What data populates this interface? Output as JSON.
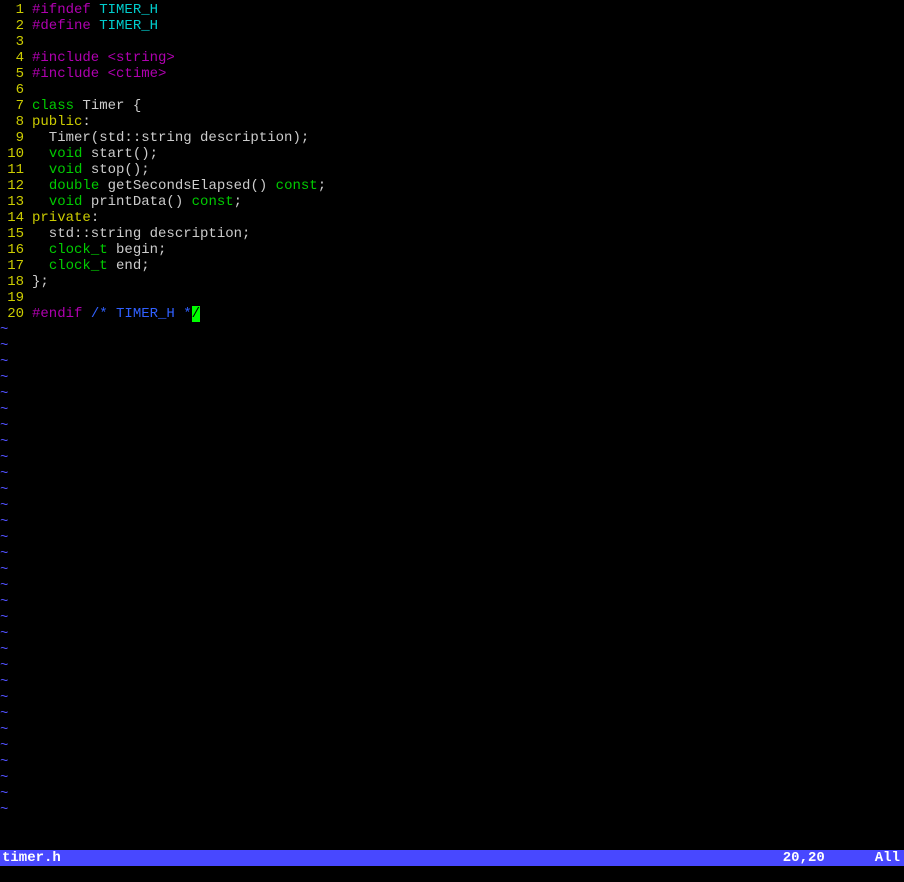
{
  "status": {
    "filename": "timer.h",
    "position": "20,20",
    "percent": "All"
  },
  "emptyLineMarker": "~",
  "emptyLineCount": 31,
  "lines": [
    {
      "num": "1",
      "segments": [
        {
          "cls": "c-preproc",
          "text": "#ifndef "
        },
        {
          "cls": "c-ident",
          "text": "TIMER_H"
        }
      ]
    },
    {
      "num": "2",
      "segments": [
        {
          "cls": "c-preproc",
          "text": "#define "
        },
        {
          "cls": "c-ident",
          "text": "TIMER_H"
        }
      ]
    },
    {
      "num": "3",
      "segments": []
    },
    {
      "num": "4",
      "segments": [
        {
          "cls": "c-preproc",
          "text": "#include "
        },
        {
          "cls": "c-string",
          "text": "<string>"
        }
      ]
    },
    {
      "num": "5",
      "segments": [
        {
          "cls": "c-preproc",
          "text": "#include "
        },
        {
          "cls": "c-string",
          "text": "<ctime>"
        }
      ]
    },
    {
      "num": "6",
      "segments": []
    },
    {
      "num": "7",
      "segments": [
        {
          "cls": "c-type",
          "text": "class"
        },
        {
          "cls": "c-plain",
          "text": " Timer {"
        }
      ]
    },
    {
      "num": "8",
      "segments": [
        {
          "cls": "c-keyword",
          "text": "public"
        },
        {
          "cls": "c-plain",
          "text": ":"
        }
      ]
    },
    {
      "num": "9",
      "segments": [
        {
          "cls": "c-plain",
          "text": "  Timer(std::string description);"
        }
      ]
    },
    {
      "num": "10",
      "segments": [
        {
          "cls": "c-plain",
          "text": "  "
        },
        {
          "cls": "c-type",
          "text": "void"
        },
        {
          "cls": "c-plain",
          "text": " start();"
        }
      ]
    },
    {
      "num": "11",
      "segments": [
        {
          "cls": "c-plain",
          "text": "  "
        },
        {
          "cls": "c-type",
          "text": "void"
        },
        {
          "cls": "c-plain",
          "text": " stop();"
        }
      ]
    },
    {
      "num": "12",
      "segments": [
        {
          "cls": "c-plain",
          "text": "  "
        },
        {
          "cls": "c-type",
          "text": "double"
        },
        {
          "cls": "c-plain",
          "text": " getSecondsElapsed() "
        },
        {
          "cls": "c-type",
          "text": "const"
        },
        {
          "cls": "c-plain",
          "text": ";"
        }
      ]
    },
    {
      "num": "13",
      "segments": [
        {
          "cls": "c-plain",
          "text": "  "
        },
        {
          "cls": "c-type",
          "text": "void"
        },
        {
          "cls": "c-plain",
          "text": " printData() "
        },
        {
          "cls": "c-type",
          "text": "const"
        },
        {
          "cls": "c-plain",
          "text": ";"
        }
      ]
    },
    {
      "num": "14",
      "segments": [
        {
          "cls": "c-keyword",
          "text": "private"
        },
        {
          "cls": "c-plain",
          "text": ":"
        }
      ]
    },
    {
      "num": "15",
      "segments": [
        {
          "cls": "c-plain",
          "text": "  std::string description;"
        }
      ]
    },
    {
      "num": "16",
      "segments": [
        {
          "cls": "c-plain",
          "text": "  "
        },
        {
          "cls": "c-type",
          "text": "clock_t"
        },
        {
          "cls": "c-plain",
          "text": " begin;"
        }
      ]
    },
    {
      "num": "17",
      "segments": [
        {
          "cls": "c-plain",
          "text": "  "
        },
        {
          "cls": "c-type",
          "text": "clock_t"
        },
        {
          "cls": "c-plain",
          "text": " end;"
        }
      ]
    },
    {
      "num": "18",
      "segments": [
        {
          "cls": "c-plain",
          "text": "};"
        }
      ]
    },
    {
      "num": "19",
      "segments": []
    },
    {
      "num": "20",
      "segments": [
        {
          "cls": "c-preproc",
          "text": "#endif "
        },
        {
          "cls": "c-comment",
          "text": "/* TIMER_H *"
        },
        {
          "cls": "c-comment cursor",
          "text": "/"
        }
      ]
    }
  ]
}
